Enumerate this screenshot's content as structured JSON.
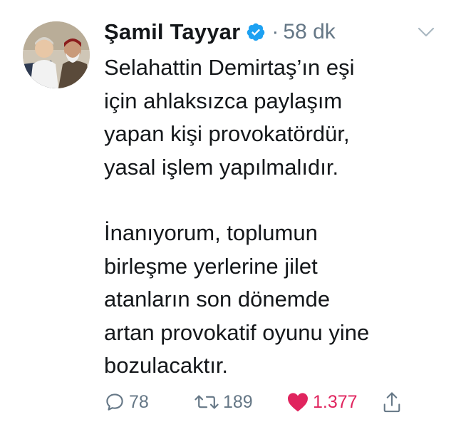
{
  "tweet": {
    "author": {
      "display_name": "Şamil Tayyar",
      "verified": true
    },
    "time_ago": "58 dk",
    "separator": "·",
    "paragraphs": [
      [
        "Selahattin Demirtaş’ın eşi",
        "için ahlaksızca paylaşım",
        "yapan kişi provokatördür,",
        "yasal işlem yapılmalıdır."
      ],
      [
        "İnanıyorum, toplumun",
        "birleşme yerlerine jilet",
        "atanların son dönemde",
        "artan provokatif oyunu yine",
        "bozulacaktır."
      ]
    ],
    "actions": {
      "replies": "78",
      "retweets": "189",
      "likes": "1.377",
      "liked": true
    }
  },
  "colors": {
    "text": "#14171a",
    "muted": "#657786",
    "verified_badge": "#1da1f2",
    "like": "#e0245e"
  },
  "icons": [
    "verified-badge-icon",
    "chevron-down-icon",
    "reply-icon",
    "retweet-icon",
    "heart-icon",
    "share-icon"
  ]
}
